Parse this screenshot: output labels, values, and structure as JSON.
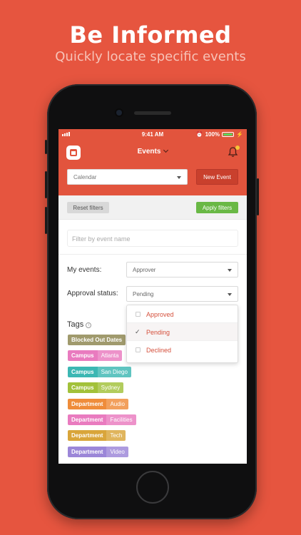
{
  "promo": {
    "title": "Be Informed",
    "subtitle": "Quickly locate specific events"
  },
  "statusbar": {
    "time": "9:41 AM",
    "battery": "100%"
  },
  "nav": {
    "title": "Events"
  },
  "calendar": {
    "select_value": "Calendar",
    "new_event_label": "New Event"
  },
  "filters": {
    "reset_label": "Reset filters",
    "apply_label": "Apply filters",
    "name_placeholder": "Filter by event name",
    "my_events_label": "My events:",
    "my_events_value": "Approver",
    "approval_label": "Approval status:",
    "approval_value": "Pending",
    "approval_options": [
      "Approved",
      "Pending",
      "Declined"
    ]
  },
  "tags": {
    "title": "Tags",
    "items": [
      {
        "key": "Blocked Out Dates",
        "value": "",
        "color": "#a09a6d"
      },
      {
        "key": "Campus",
        "value": "Atlanta",
        "color": "#e97bbf"
      },
      {
        "key": "Campus",
        "value": "San Diego",
        "color": "#3cb7b3"
      },
      {
        "key": "Campus",
        "value": "Sydney",
        "color": "#a2c13a"
      },
      {
        "key": "Department",
        "value": "Audio",
        "color": "#ef8c3a"
      },
      {
        "key": "Department",
        "value": "Facilities",
        "color": "#e97bbf"
      },
      {
        "key": "Department",
        "value": "Tech",
        "color": "#d9a53a"
      },
      {
        "key": "Department",
        "value": "Video",
        "color": "#9b86d8"
      }
    ]
  }
}
